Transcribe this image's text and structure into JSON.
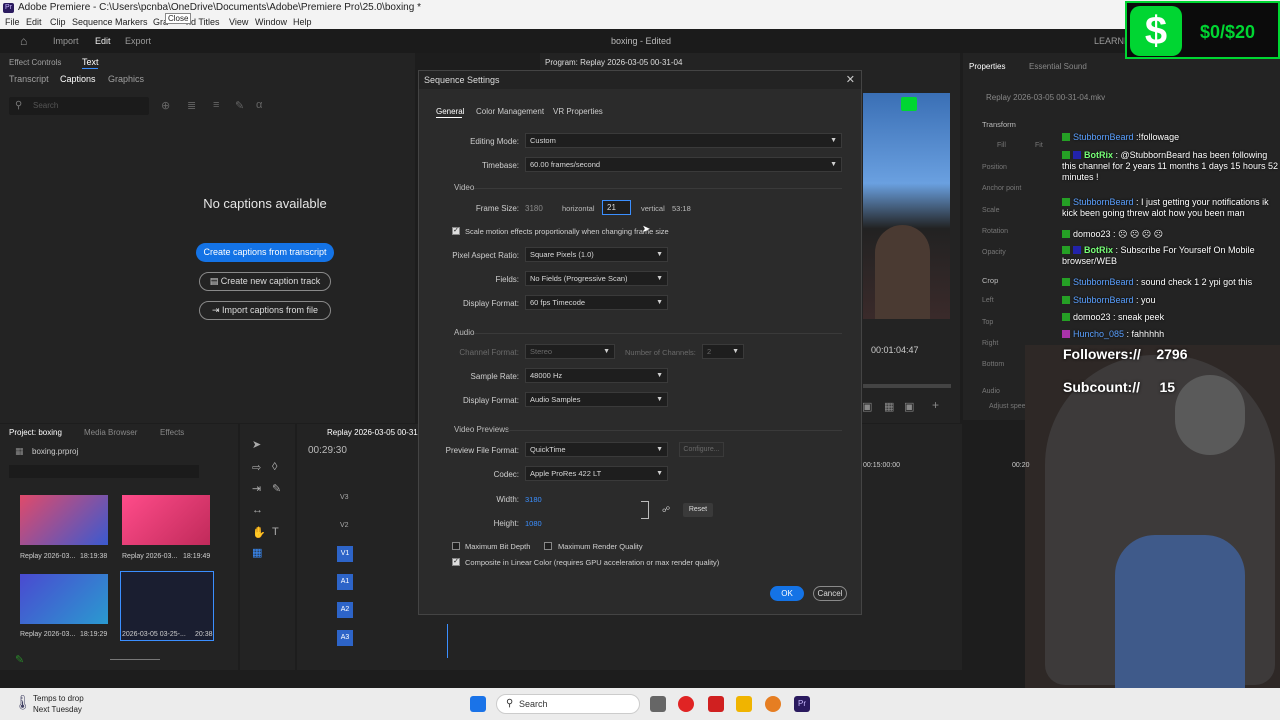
{
  "window": {
    "title": "Adobe Premiere - C:\\Users\\pcnba\\OneDrive\\Documents\\Adobe\\Premiere Pro\\25.0\\boxing *",
    "tooltip": "Close"
  },
  "menu": [
    "File",
    "Edit",
    "Clip",
    "Sequence",
    "Markers",
    "Gra",
    "nd Titles",
    "View",
    "Window",
    "Help"
  ],
  "workspace": {
    "tabs": [
      "Import",
      "Edit",
      "Export"
    ],
    "project_title": "boxing - Edited",
    "right_label": "LEARNIN"
  },
  "left_panel": {
    "tabs": [
      "Effect Controls",
      "Text"
    ],
    "subtabs": [
      "Transcript",
      "Captions",
      "Graphics"
    ],
    "search_placeholder": "Search",
    "empty_message": "No captions available",
    "btn_transcript": "Create captions from transcript",
    "btn_new_track": "Create new caption track",
    "btn_import": "Import captions from file"
  },
  "project": {
    "tabs": [
      "Project: boxing",
      "Media Browser",
      "Effects"
    ],
    "file": "boxing.prproj",
    "items": [
      {
        "name": "Replay 2026-03...",
        "duration": "18:19:38"
      },
      {
        "name": "Replay 2026-03...",
        "duration": "18:19:49"
      },
      {
        "name": "Replay 2026-03...",
        "duration": "18:19:29"
      },
      {
        "name": "2026-03-05 03-25-...",
        "duration": "20:38"
      }
    ]
  },
  "timeline": {
    "tab": "Replay 2026-03-05 00-31-04",
    "timecode": "00:29:30",
    "ruler": [
      "00:15:00:00",
      "00:20"
    ],
    "tracks": [
      "V3",
      "V2",
      "V1",
      "A1",
      "A2",
      "A3"
    ]
  },
  "program": {
    "tab": "Program: Replay 2026-03-05 00-31-04",
    "timecode": "00:01:04:47"
  },
  "properties": {
    "tabs": [
      "Properties",
      "Essential Sound"
    ],
    "clip": "Replay 2026-03-05 00-31-04.mkv",
    "items": [
      "Transform",
      "Fill",
      "Fit",
      "Position",
      "Anchor point",
      "Scale",
      "Rotation",
      "Opacity",
      "Crop",
      "Left",
      "Top",
      "Right",
      "Bottom",
      "Audio",
      "Adjust speed..."
    ]
  },
  "dialog": {
    "title": "Sequence Settings",
    "tabs": [
      "General",
      "Color Management",
      "VR Properties"
    ],
    "editing_mode_label": "Editing Mode:",
    "editing_mode": "Custom",
    "timebase_label": "Timebase:",
    "timebase": "60.00 frames/second",
    "video_section": "Video",
    "frame_size_label": "Frame Size:",
    "frame_w": "3180",
    "horizontal": "horizontal",
    "frame_h": "21",
    "vertical": "vertical",
    "aspect": "53:18",
    "scale_motion": "Scale motion effects proportionally when changing frame size",
    "par_label": "Pixel Aspect Ratio:",
    "par": "Square Pixels (1.0)",
    "fields_label": "Fields:",
    "fields": "No Fields (Progressive Scan)",
    "display_format_label": "Display Format:",
    "display_format": "60 fps Timecode",
    "audio_section": "Audio",
    "channel_format_label": "Channel Format:",
    "channel_format": "Stereo",
    "num_channels_label": "Number of Channels:",
    "num_channels": "2",
    "sample_rate_label": "Sample Rate:",
    "sample_rate": "48000 Hz",
    "audio_display_label": "Display Format:",
    "audio_display": "Audio Samples",
    "previews_section": "Video Previews",
    "preview_format_label": "Preview File Format:",
    "preview_format": "QuickTime",
    "configure": "Configure...",
    "codec_label": "Codec:",
    "codec": "Apple ProRes 422 LT",
    "width_label": "Width:",
    "width": "3180",
    "height_label": "Height:",
    "height": "1080",
    "reset": "Reset",
    "max_bit_depth": "Maximum Bit Depth",
    "max_render": "Maximum Render Quality",
    "composite": "Composite in Linear Color (requires GPU acceleration or max render quality)",
    "ok": "OK",
    "cancel": "Cancel"
  },
  "chat": [
    {
      "name": "StubbornBeard",
      "text": " :!followage"
    },
    {
      "name": "BotRix",
      "text": " : @StubbornBeard has been following this channel for 2 years 11 months 1 days 15 hours 52 minutes !"
    },
    {
      "name": "StubbornBeard",
      "text": " : I just getting your notifications ik kick been going threw alot how you been man"
    },
    {
      "name": "domoo23",
      "text": " : ☹ ☹ ☹ ☹"
    },
    {
      "name": "BotRix",
      "text": " : Subscribe For Yourself On Mobile browser/WEB"
    },
    {
      "name": "StubbornBeard",
      "text": " : sound check 1 2 ypi got this"
    },
    {
      "name": "StubbornBeard",
      "text": " : you"
    },
    {
      "name": "domoo23",
      "text": " : sneak peek"
    },
    {
      "name": "Huncho_085",
      "text": " : fahhhhh"
    }
  ],
  "stats": {
    "followers_label": "Followers://",
    "followers": "2796",
    "subcount_label": "Subcount://",
    "subcount": "15"
  },
  "cashapp": {
    "symbol": "$",
    "goal": "$0/$20"
  },
  "taskbar": {
    "weather_title": "Temps to drop",
    "weather_sub": "Next Tuesday",
    "search": "Search"
  }
}
